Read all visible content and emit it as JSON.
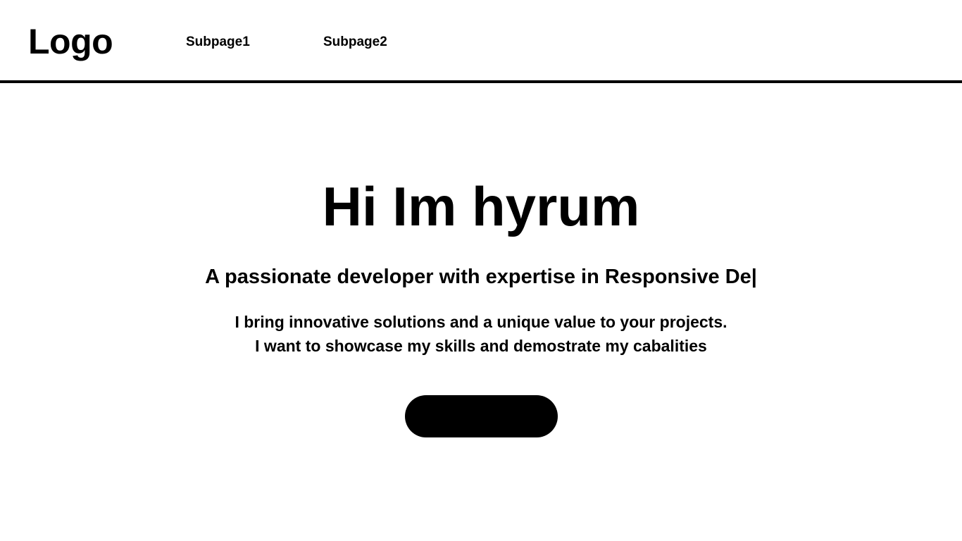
{
  "header": {
    "logo": "Logo",
    "nav": [
      {
        "label": "Subpage1"
      },
      {
        "label": "Subpage2"
      }
    ]
  },
  "hero": {
    "title": "Hi Im hyrum",
    "subtitle": "A passionate developer with expertise in Responsive De|",
    "description": "I bring innovative solutions and a unique value to your projects. I want to showcase my skills and demostrate my cabalities",
    "button_color": "#000000"
  }
}
